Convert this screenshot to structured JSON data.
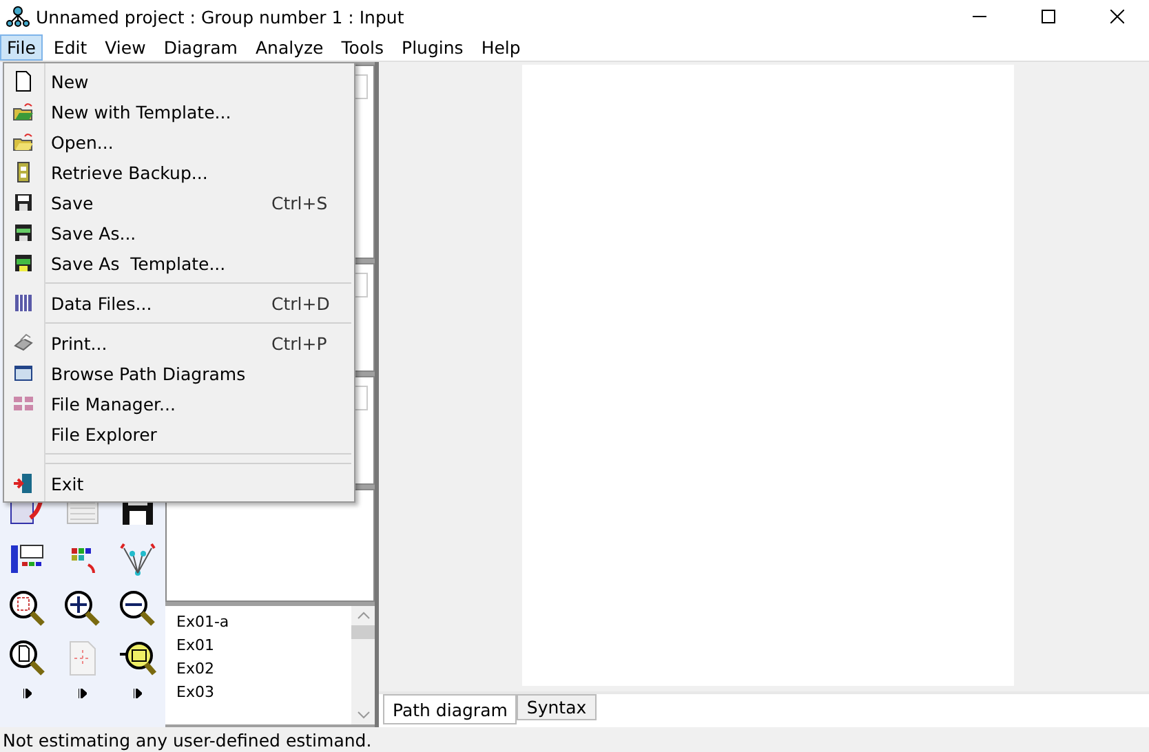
{
  "window": {
    "title": "Unnamed project : Group number 1 : Input"
  },
  "menubar": [
    {
      "label": "File",
      "selected": true
    },
    {
      "label": "Edit",
      "selected": false
    },
    {
      "label": "View",
      "selected": false
    },
    {
      "label": "Diagram",
      "selected": false
    },
    {
      "label": "Analyze",
      "selected": false
    },
    {
      "label": "Tools",
      "selected": false
    },
    {
      "label": "Plugins",
      "selected": false
    },
    {
      "label": "Help",
      "selected": false
    }
  ],
  "file_menu": [
    {
      "kind": "item",
      "label": "New"
    },
    {
      "kind": "item",
      "label": "New with Template..."
    },
    {
      "kind": "item",
      "label": "Open..."
    },
    {
      "kind": "item",
      "label": "Retrieve Backup..."
    },
    {
      "kind": "item",
      "label": "Save",
      "shortcut": "Ctrl+S"
    },
    {
      "kind": "item",
      "label": "Save As..."
    },
    {
      "kind": "item",
      "label": "Save As  Template..."
    },
    {
      "kind": "separator"
    },
    {
      "kind": "item",
      "label": "Data Files...",
      "shortcut": "Ctrl+D"
    },
    {
      "kind": "separator"
    },
    {
      "kind": "item",
      "label": "Print...",
      "shortcut": "Ctrl+P"
    },
    {
      "kind": "item",
      "label": "Browse Path Diagrams"
    },
    {
      "kind": "item",
      "label": "File Manager..."
    },
    {
      "kind": "item",
      "label": "File Explorer"
    },
    {
      "kind": "separator"
    },
    {
      "kind": "separator"
    },
    {
      "kind": "item",
      "label": "Exit"
    }
  ],
  "models_list": [
    "Ex01-a",
    "Ex01",
    "Ex02",
    "Ex03"
  ],
  "tabs": [
    {
      "label": "Path diagram",
      "selected": true
    },
    {
      "label": "Syntax",
      "selected": false
    }
  ],
  "status_bar": "Not estimating any user-defined estimand."
}
